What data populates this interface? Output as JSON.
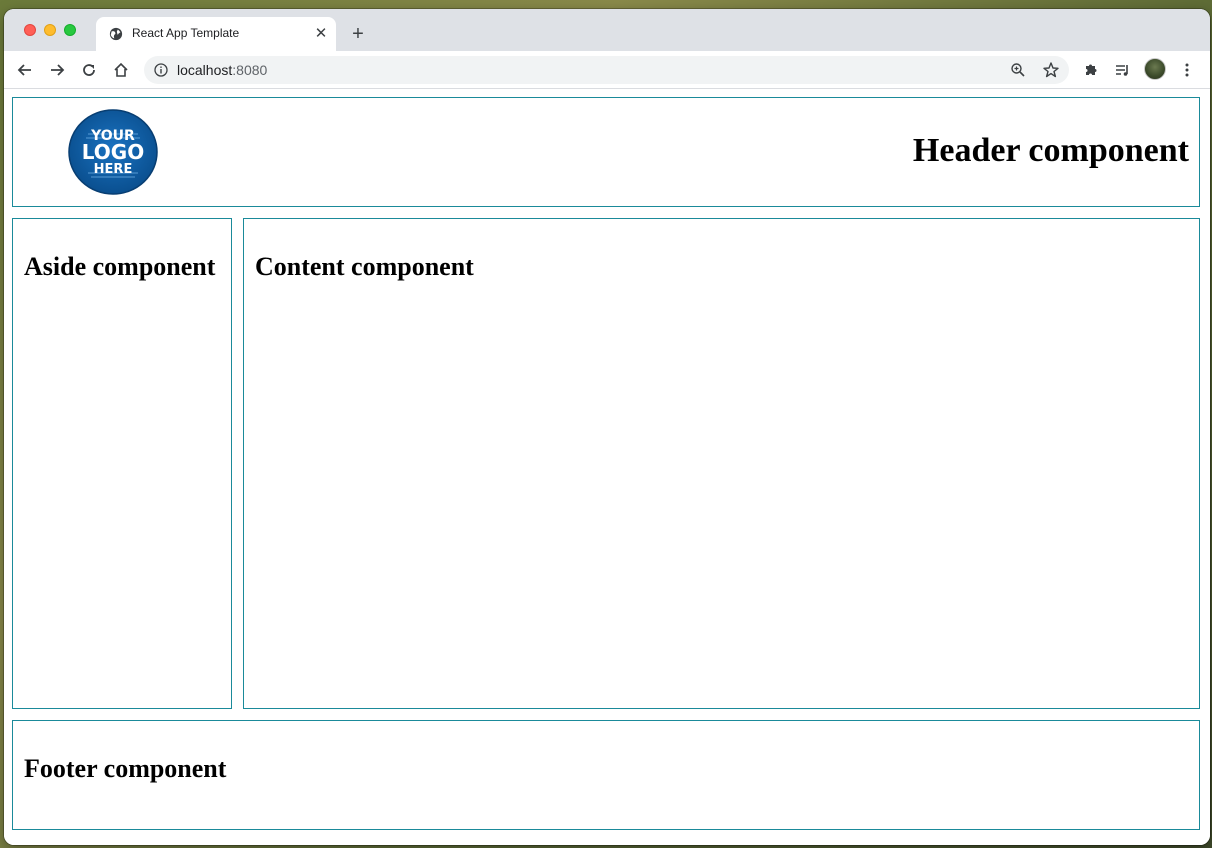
{
  "browser": {
    "tab_title": "React App Template",
    "tab_close": "✕",
    "new_tab": "+",
    "url_host": "localhost",
    "url_port": ":8080"
  },
  "page": {
    "logo_text": [
      "YOUR",
      "LOGO",
      "HERE"
    ],
    "header_title": "Header component",
    "aside_title": "Aside component",
    "content_title": "Content component",
    "footer_title": "Footer component"
  },
  "colors": {
    "box_border": "#1a8a9a",
    "logo_blue": "#0f5fa8"
  }
}
